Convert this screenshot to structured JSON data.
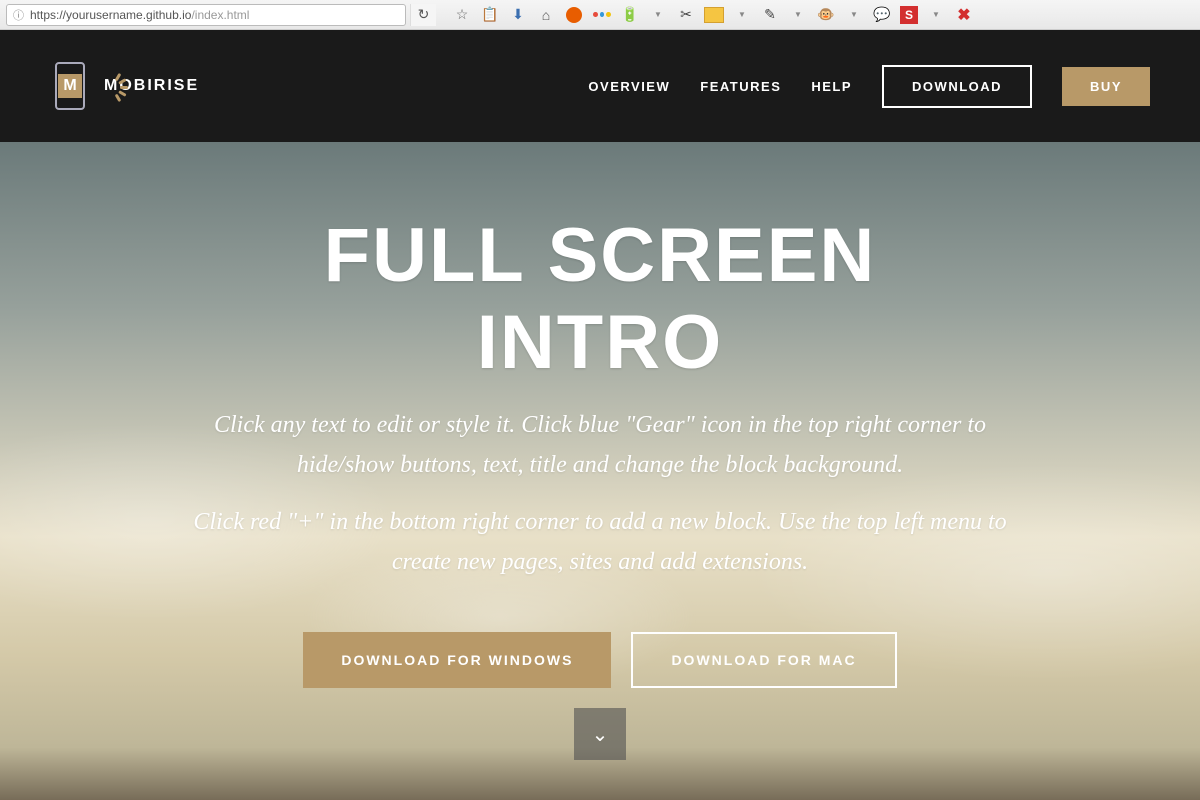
{
  "browser": {
    "url_host": "https://yourusername.github.io",
    "url_path": "/index.html"
  },
  "header": {
    "brand": "MOBIRISE",
    "logo_letter": "M",
    "nav": {
      "overview": "OVERVIEW",
      "features": "FEATURES",
      "help": "HELP",
      "download": "DOWNLOAD",
      "buy": "BUY"
    }
  },
  "hero": {
    "title": "FULL SCREEN INTRO",
    "subtitle1": "Click any text to edit or style it. Click blue \"Gear\" icon in the top right corner to hide/show buttons, text, title and change the block background.",
    "subtitle2": "Click red \"+\" in the bottom right corner to add a new block. Use the top left menu to create new pages, sites and add extensions.",
    "btn_windows": "DOWNLOAD FOR WINDOWS",
    "btn_mac": "DOWNLOAD FOR MAC"
  },
  "colors": {
    "accent": "#b89968",
    "header_bg": "#1a1a1a"
  }
}
